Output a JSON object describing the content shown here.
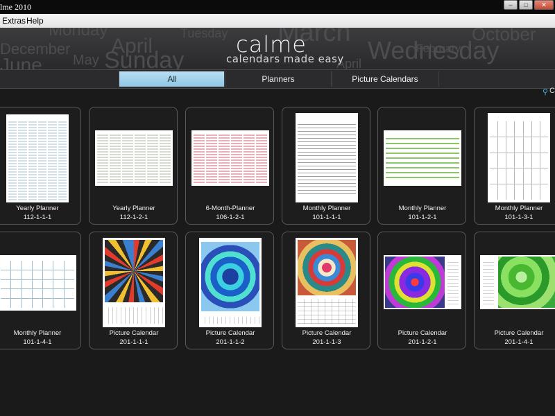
{
  "window": {
    "title": "lme 2010",
    "buttons": {
      "minimize": "–",
      "maximize": "□",
      "close": "✕"
    }
  },
  "menu": [
    "Extras",
    "Help"
  ],
  "header": {
    "logo": "calme",
    "tagline": "calendars made easy",
    "background_words": [
      "Monday",
      "Tuesday",
      "March",
      "October",
      "December",
      "April",
      "February",
      "Wednesday",
      "June",
      "May",
      "Sunday",
      "April"
    ]
  },
  "tabs": [
    {
      "label": "All",
      "active": true
    },
    {
      "label": "Planners",
      "active": false
    },
    {
      "label": "Picture Calendars",
      "active": false
    }
  ],
  "search": {
    "label": "C"
  },
  "templates": [
    {
      "name": "Yearly Planner",
      "code": "112-1-1-1",
      "thumb": "yearly-blue"
    },
    {
      "name": "Yearly Planner",
      "code": "112-1-2-1",
      "thumb": "yearly-gray"
    },
    {
      "name": "6-Month-Planner",
      "code": "106-1-2-1",
      "thumb": "yearly-red"
    },
    {
      "name": "Monthly Planner",
      "code": "101-1-1-1",
      "thumb": "monthly-lines"
    },
    {
      "name": "Monthly Planner",
      "code": "101-1-2-1",
      "thumb": "monthly-green"
    },
    {
      "name": "Monthly Planner",
      "code": "101-1-3-1",
      "thumb": "monthly-grid"
    },
    {
      "name": "Monthly Planner",
      "code": "101-1-4-1",
      "thumb": "monthly-wide"
    },
    {
      "name": "Picture Calendar",
      "code": "201-1-1-1",
      "thumb": "picture-star"
    },
    {
      "name": "Picture Calendar",
      "code": "201-1-1-2",
      "thumb": "picture-blue"
    },
    {
      "name": "Picture Calendar",
      "code": "201-1-1-3",
      "thumb": "picture-red"
    },
    {
      "name": "Picture Calendar",
      "code": "201-1-2-1",
      "thumb": "picture-purple"
    },
    {
      "name": "Picture Calendar",
      "code": "201-1-4-1",
      "thumb": "picture-green"
    }
  ]
}
